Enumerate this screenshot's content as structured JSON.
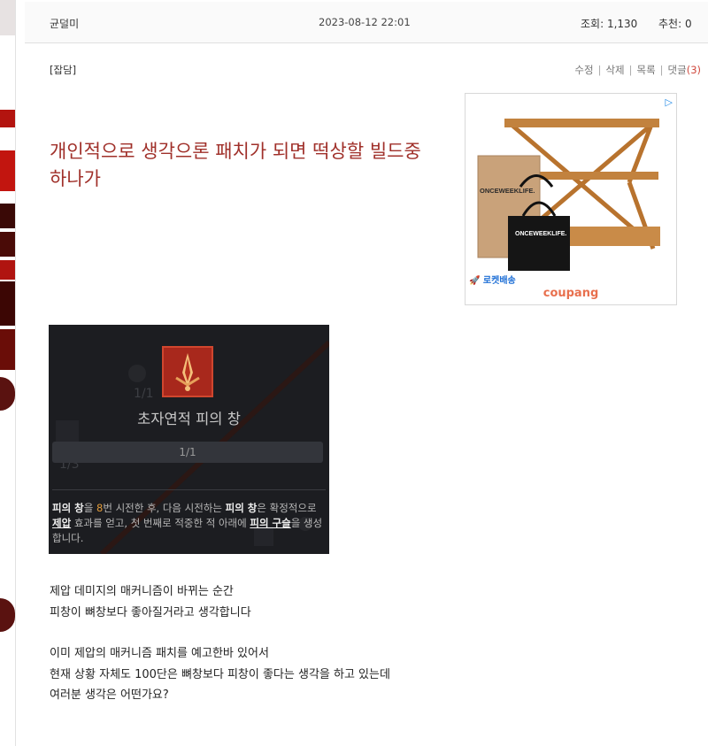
{
  "post": {
    "author": "균덜미",
    "date": "2023-08-12 22:01",
    "views_label": "조회: 1,130",
    "recommend_label": "추천: 0",
    "category": "[잡담]",
    "actions": {
      "edit": "수정",
      "delete": "삭제",
      "list": "목록",
      "comments": "댓글",
      "comment_count": "(3)"
    },
    "title": "개인적으로 생각으론 패치가 되면 떡상할 빌드중 하나가",
    "body_lines": [
      "제압 데미지의 매커니즘이 바뀌는 순간",
      "피창이 뼈창보다 좋아질거라고 생각합니다",
      "",
      "이미 제압의 매커니즘 패치를 예고한바 있어서",
      "현재 상황 자체도 100단은 뼈창보다 피창이 좋다는 생각을 하고 있는데",
      "여러분 생각은 어떤가요?"
    ]
  },
  "ad": {
    "badge": "▷",
    "brand1": "ONCEWEEKLIFE.",
    "brand2": "ONCEWEEKLIFE.",
    "rocket": "🚀 로켓배송",
    "coupang": "coupang"
  },
  "skill": {
    "ghost_1": "1/1",
    "ghost_2": "1/3",
    "name": "초자연적 피의 창",
    "rank": "1/1",
    "desc": {
      "t1": "피의 창",
      "t2": "을 ",
      "t3": "8",
      "t4": "번 시전한 후, 다음 시전하는 ",
      "t5": "피의 창",
      "t6": "은 확정적으로 ",
      "t7": "제압",
      "t8": " 효과를 얻고, 첫 번째로 적중한 적 아래에 ",
      "t9": "피의 구슬",
      "t10": "을 생성합니다."
    }
  },
  "colors": {
    "title": "#a0302a",
    "accent_red": "#a8281c",
    "comment_count": "#d04a3e"
  }
}
